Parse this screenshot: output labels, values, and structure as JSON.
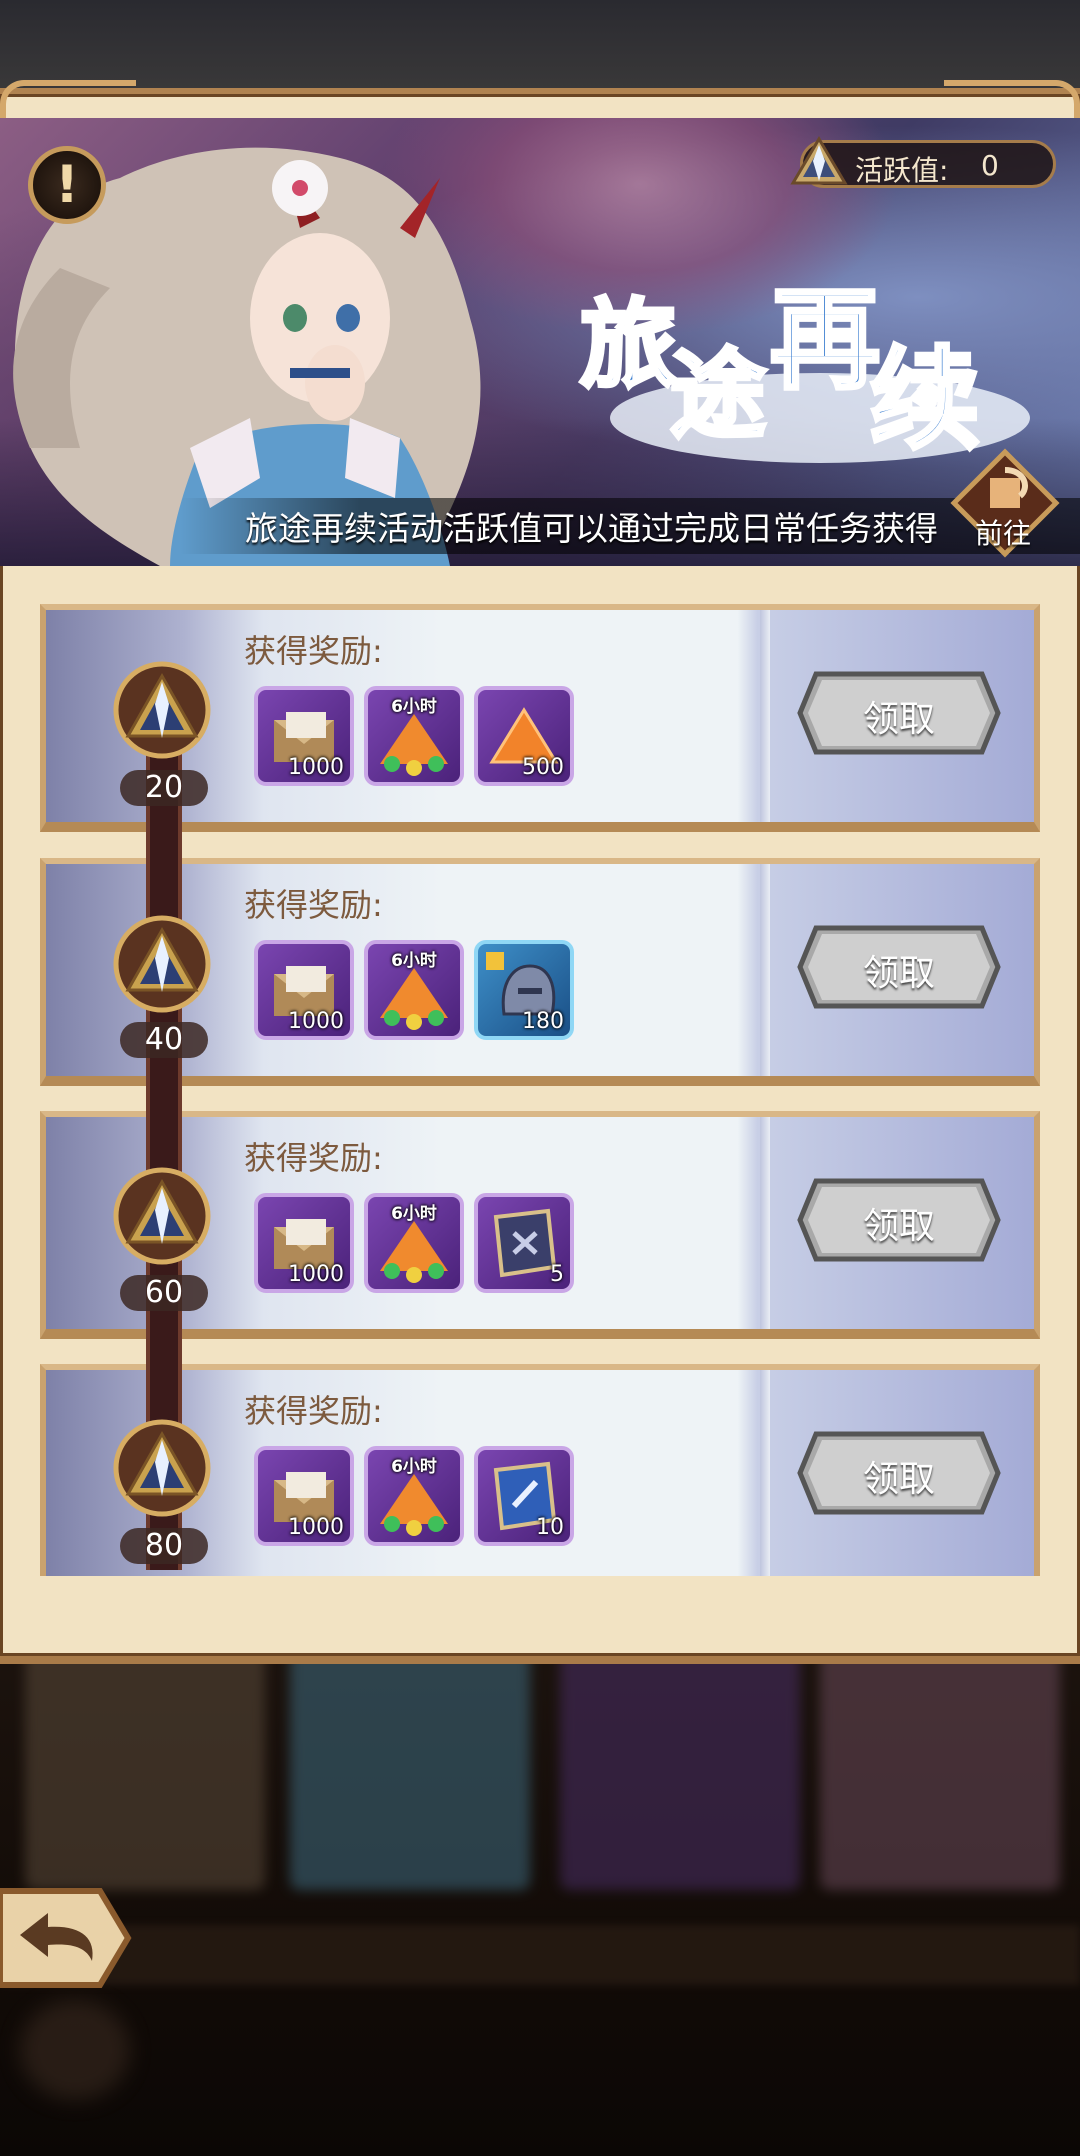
{
  "header": {
    "activity_label": "活跃值:",
    "activity_value": "0",
    "description": "旅途再续活动活跃值可以通过完成日常任务获得",
    "go_label": "前往",
    "title_art_text": [
      "旅",
      "途",
      "再",
      "续"
    ]
  },
  "rewards_label": "获得奖励:",
  "claim_label": "领取",
  "milestones": [
    {
      "value": "20",
      "items": [
        {
          "icon": "envelope-icon",
          "count": "1000",
          "tag": ""
        },
        {
          "icon": "gold-pile-icon",
          "count": "",
          "tag": "6小时"
        },
        {
          "icon": "orange-crystal-icon",
          "count": "500",
          "tag": ""
        }
      ]
    },
    {
      "value": "40",
      "items": [
        {
          "icon": "envelope-icon",
          "count": "1000",
          "tag": ""
        },
        {
          "icon": "gold-pile-icon",
          "count": "",
          "tag": "6小时"
        },
        {
          "icon": "helmet-puzzle-icon",
          "count": "180",
          "tag": ""
        }
      ]
    },
    {
      "value": "60",
      "items": [
        {
          "icon": "envelope-icon",
          "count": "1000",
          "tag": ""
        },
        {
          "icon": "gold-pile-icon",
          "count": "",
          "tag": "6小时"
        },
        {
          "icon": "scroll-icon",
          "count": "5",
          "tag": ""
        }
      ]
    },
    {
      "value": "80",
      "items": [
        {
          "icon": "envelope-icon",
          "count": "1000",
          "tag": ""
        },
        {
          "icon": "gold-pile-icon",
          "count": "",
          "tag": "6小时"
        },
        {
          "icon": "blue-scroll-icon",
          "count": "10",
          "tag": ""
        }
      ]
    }
  ],
  "colors": {
    "panel": "#f2e3c3",
    "frame": "#c9a26e",
    "accent_text": "#7d5a3e"
  }
}
